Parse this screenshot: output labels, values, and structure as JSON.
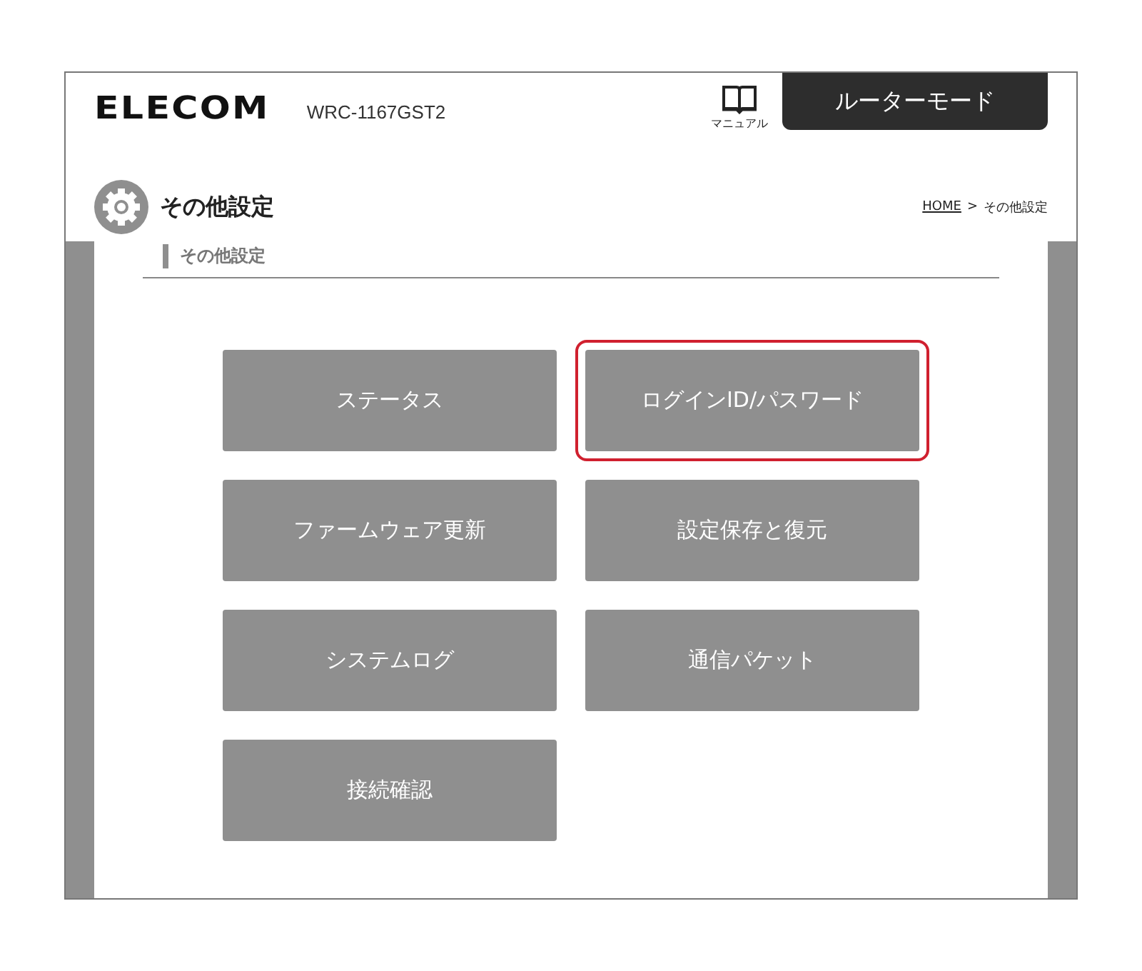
{
  "header": {
    "logo": "ELECOM",
    "model": "WRC-1167GST2",
    "manual_label": "マニュアル",
    "mode_tab": "ルーターモード"
  },
  "page": {
    "title": "その他設定",
    "breadcrumb": [
      "HOME",
      "その他設定"
    ],
    "breadcrumb_separator": ">",
    "section": "その他設定"
  },
  "menu": [
    {
      "label": "ステータス",
      "highlighted": false
    },
    {
      "label": "ログインID/パスワード",
      "highlighted": true
    },
    {
      "label": "ファームウェア更新",
      "highlighted": false
    },
    {
      "label": "設定保存と復元",
      "highlighted": false
    },
    {
      "label": "システムログ",
      "highlighted": false
    },
    {
      "label": "通信パケット",
      "highlighted": false
    },
    {
      "label": "接続確認",
      "highlighted": false
    }
  ]
}
